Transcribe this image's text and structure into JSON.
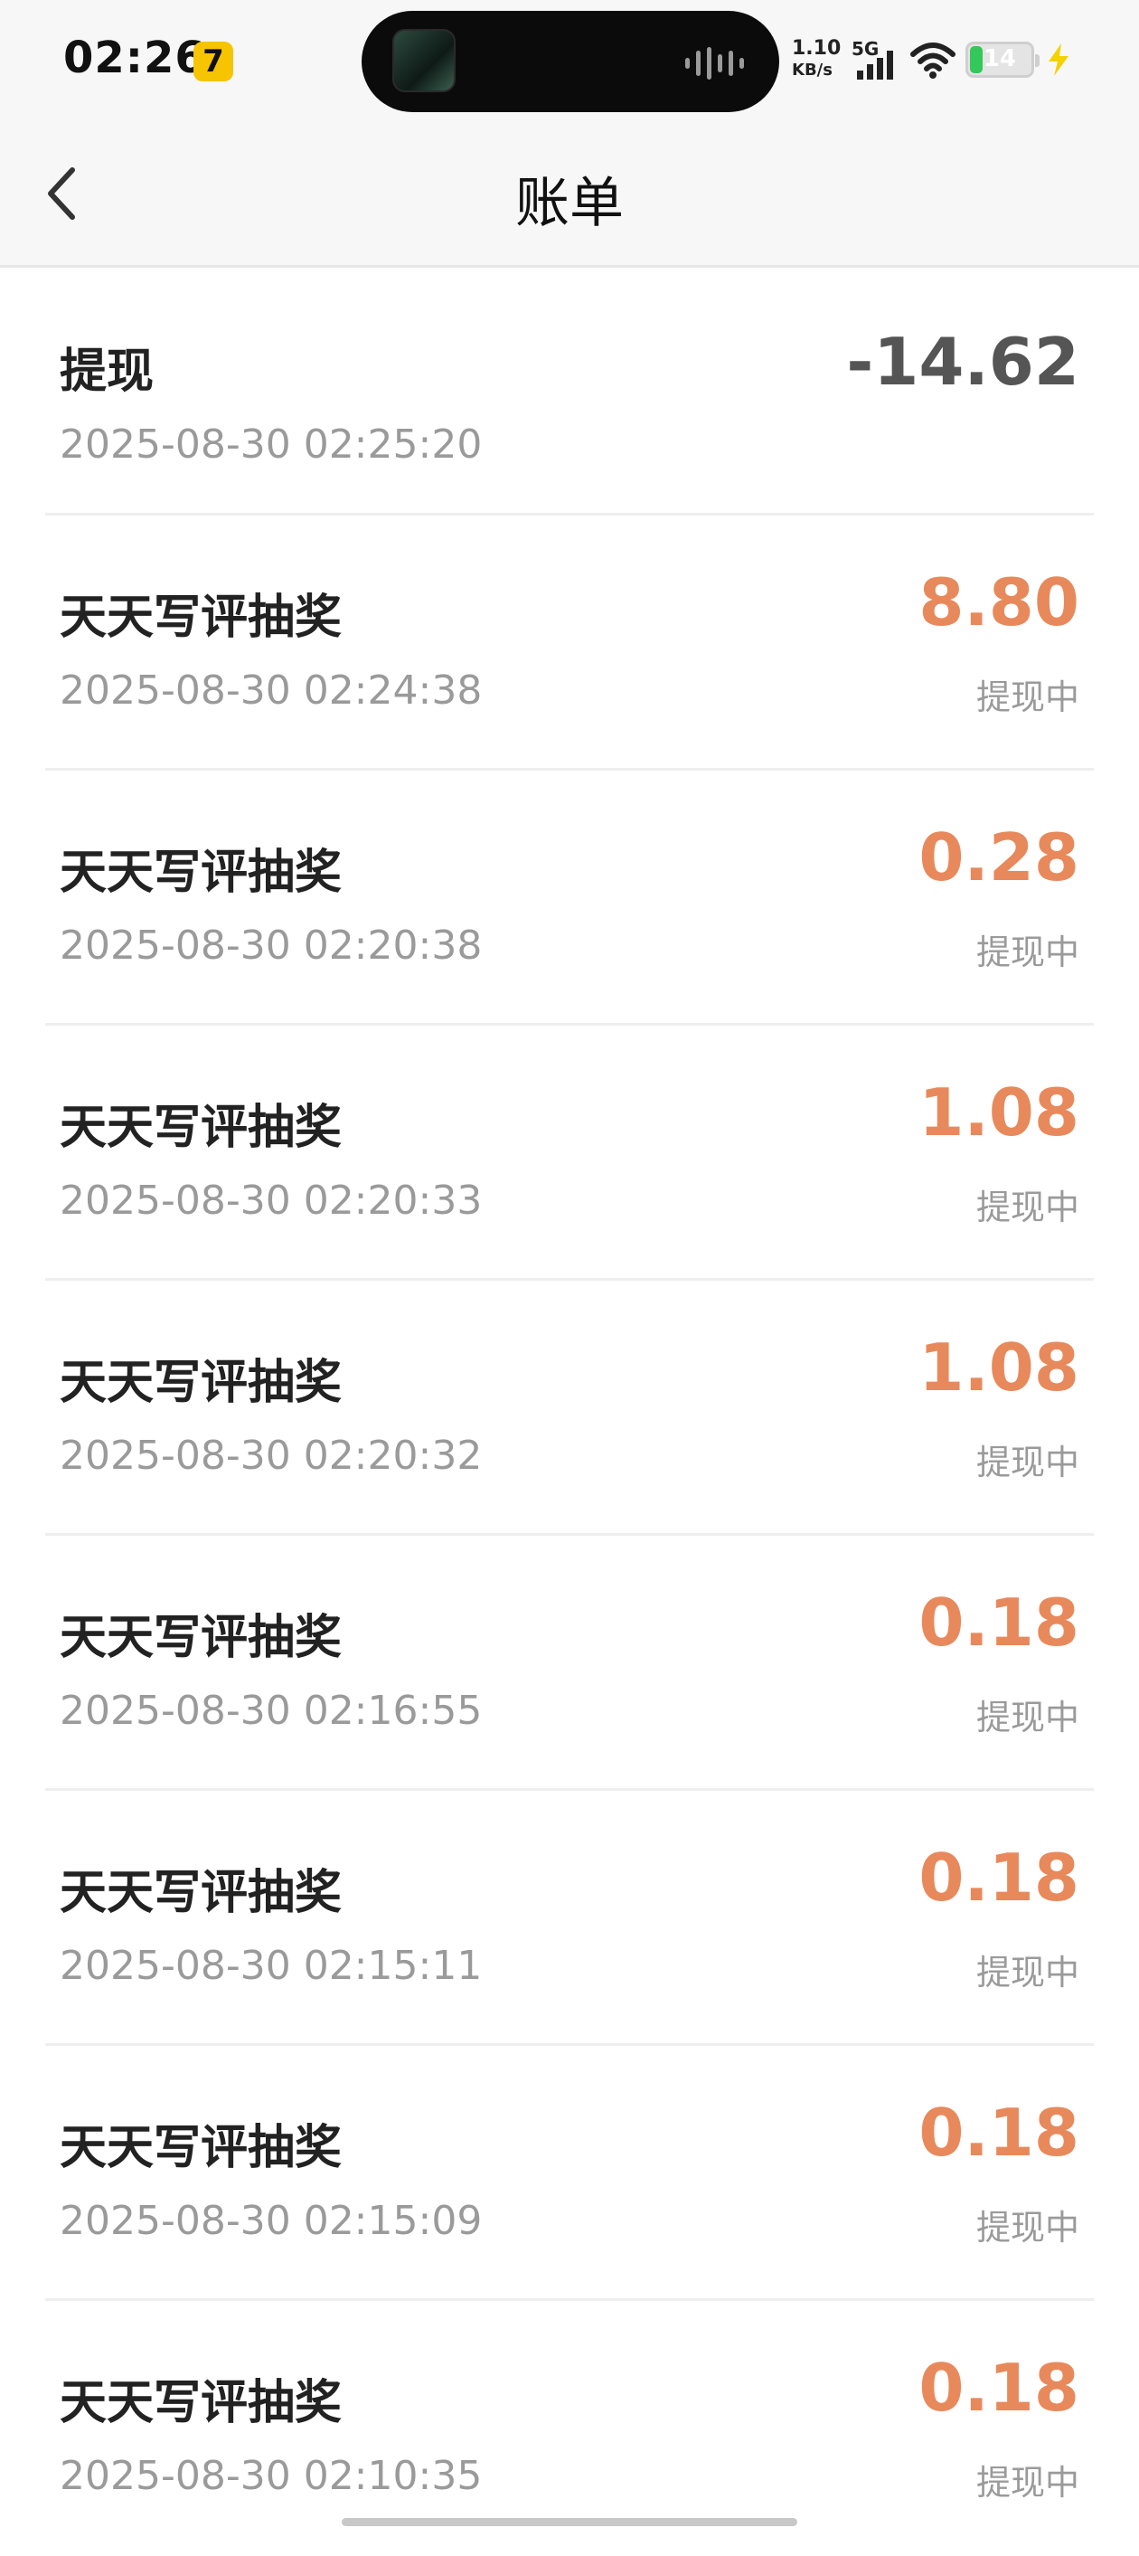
{
  "status_bar": {
    "time": "02:26",
    "net_speed_value": "1.10",
    "net_speed_unit": "KB/s",
    "network_type": "5G",
    "battery_level": "14",
    "icons": [
      "app-notification-icon",
      "now-playing-thumbnail-icon",
      "audio-wave-icon",
      "signal-icon",
      "wifi-icon",
      "battery-icon",
      "charging-icon"
    ]
  },
  "navbar": {
    "title": "账单",
    "back_icon": "chevron-left-icon"
  },
  "bills": [
    {
      "name": "提现",
      "date": "2025-08-30 02:25:20",
      "amount": "-14.62",
      "status": ""
    },
    {
      "name": "天天写评抽奖",
      "date": "2025-08-30 02:24:38",
      "amount": "8.80",
      "status": "提现中"
    },
    {
      "name": "天天写评抽奖",
      "date": "2025-08-30 02:20:38",
      "amount": "0.28",
      "status": "提现中"
    },
    {
      "name": "天天写评抽奖",
      "date": "2025-08-30 02:20:33",
      "amount": "1.08",
      "status": "提现中"
    },
    {
      "name": "天天写评抽奖",
      "date": "2025-08-30 02:20:32",
      "amount": "1.08",
      "status": "提现中"
    },
    {
      "name": "天天写评抽奖",
      "date": "2025-08-30 02:16:55",
      "amount": "0.18",
      "status": "提现中"
    },
    {
      "name": "天天写评抽奖",
      "date": "2025-08-30 02:15:11",
      "amount": "0.18",
      "status": "提现中"
    },
    {
      "name": "天天写评抽奖",
      "date": "2025-08-30 02:15:09",
      "amount": "0.18",
      "status": "提现中"
    },
    {
      "name": "天天写评抽奖",
      "date": "2025-08-30 02:10:35",
      "amount": "0.18",
      "status": "提现中"
    }
  ],
  "colors": {
    "income_amount": "#e8895c",
    "withdraw_amount": "#555555",
    "secondary_text": "#9a9a9a",
    "header_bg": "#f7f7f7"
  }
}
